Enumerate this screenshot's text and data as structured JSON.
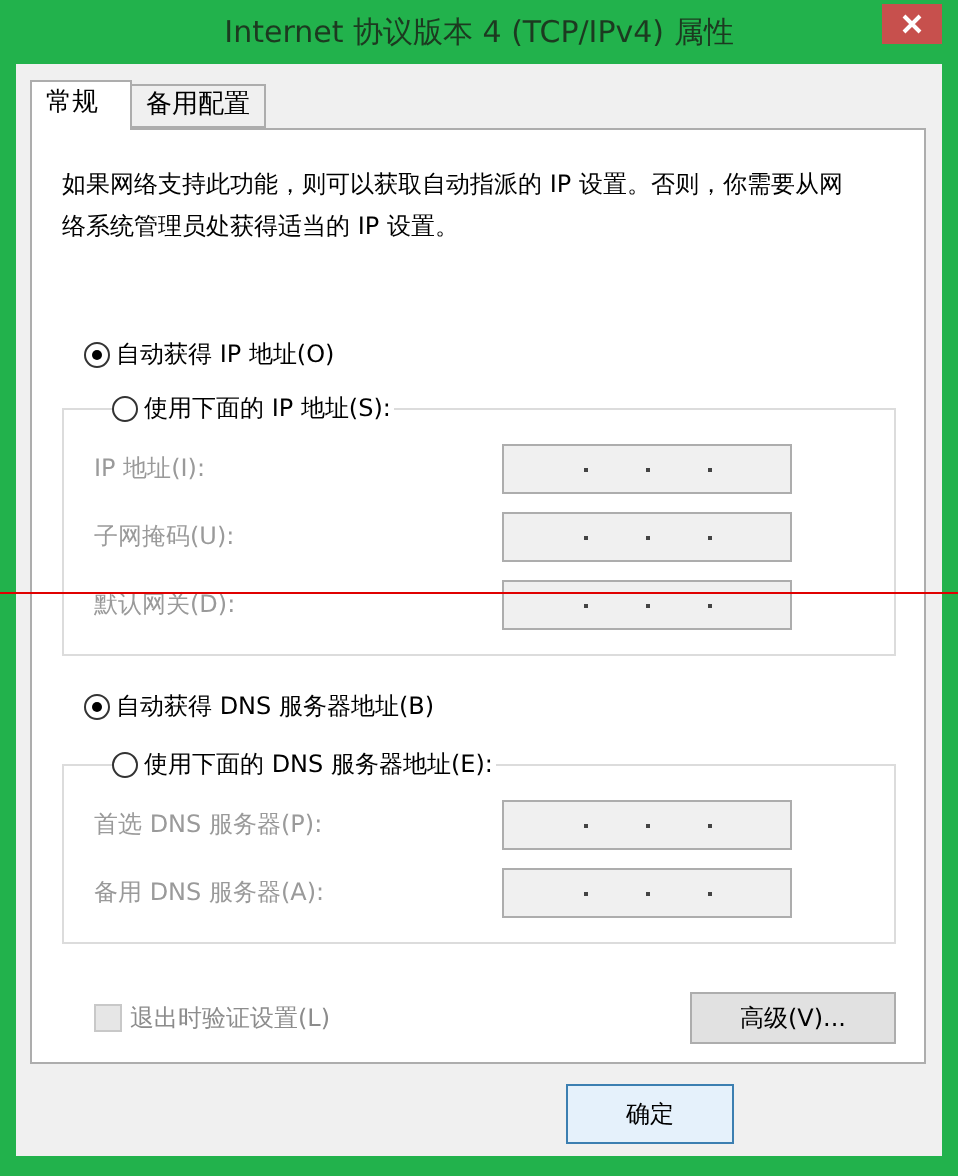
{
  "window": {
    "title": "Internet 协议版本 4 (TCP/IPv4) 属性"
  },
  "tabs": [
    {
      "label": "常规",
      "selected": true
    },
    {
      "label": "备用配置",
      "selected": false
    }
  ],
  "description": "如果网络支持此功能，则可以获取自动指派的 IP 设置。否则，你需要从网络系统管理员处获得适当的 IP 设置。",
  "ip_options": [
    {
      "label": "自动获得 IP 地址(O)",
      "selected": true
    },
    {
      "label": "使用下面的 IP 地址(S):",
      "selected": false
    }
  ],
  "ip_fields": [
    {
      "label": "IP 地址(I):",
      "disabled": true
    },
    {
      "label": "子网掩码(U):",
      "disabled": true
    },
    {
      "label": "默认网关(D):",
      "disabled": true
    }
  ],
  "dns_options": [
    {
      "label": "自动获得 DNS 服务器地址(B)",
      "selected": true
    },
    {
      "label": "使用下面的 DNS 服务器地址(E):",
      "selected": false
    }
  ],
  "dns_fields": [
    {
      "label": "首选 DNS 服务器(P):",
      "disabled": true
    },
    {
      "label": "备用 DNS 服务器(A):",
      "disabled": true
    }
  ],
  "validate_checkbox": {
    "label": "退出时验证设置(L)",
    "checked": false,
    "disabled": true
  },
  "advanced_button": "高级(V)...",
  "ok_button": "确定"
}
